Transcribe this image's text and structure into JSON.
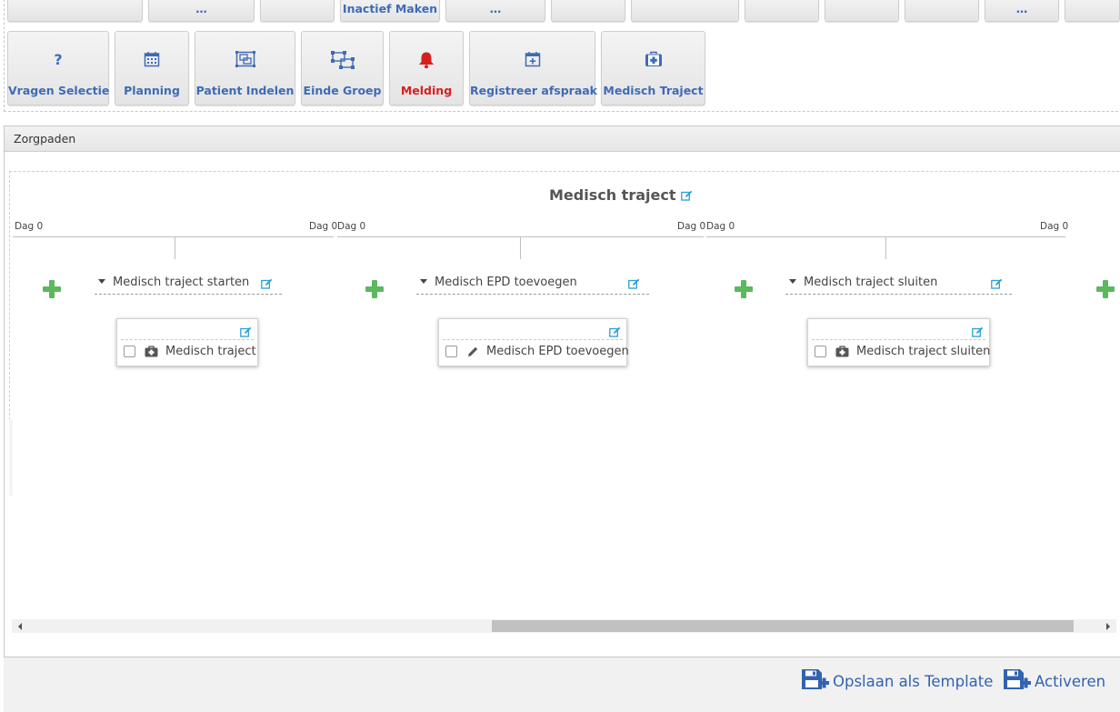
{
  "toolbar": {
    "row1": [
      {
        "label": ""
      },
      {
        "label": "…"
      },
      {
        "label": ""
      },
      {
        "label": "Inactief Maken"
      },
      {
        "label": "…"
      },
      {
        "label": ""
      },
      {
        "label": ""
      },
      {
        "label": ""
      },
      {
        "label": ""
      },
      {
        "label": ""
      },
      {
        "label": "…"
      },
      {
        "label": ""
      }
    ],
    "row2": [
      {
        "label": "Vragen Selectie",
        "icon": "question-icon"
      },
      {
        "label": "Planning",
        "icon": "calendar-icon"
      },
      {
        "label": "Patient Indelen",
        "icon": "group-icon"
      },
      {
        "label": "Einde Groep",
        "icon": "ungroup-icon"
      },
      {
        "label": "Melding",
        "icon": "bell-icon",
        "color": "#d62020"
      },
      {
        "label": "Registreer afspraak",
        "icon": "calendar-plus-icon"
      },
      {
        "label": "Medisch Traject",
        "icon": "medkit-icon"
      }
    ]
  },
  "panel": {
    "title": "Zorgpaden",
    "pathway_title": "Medisch traject",
    "timelines": [
      {
        "start": "Dag 0",
        "end": "Dag 0"
      },
      {
        "start": "Dag 0",
        "end": "Dag 0"
      },
      {
        "start": "Dag 0",
        "end": "Dag 0"
      }
    ],
    "steps": [
      {
        "title": "Medisch traject starten",
        "task": "Medisch traject",
        "task_icon": "medkit-icon"
      },
      {
        "title": "Medisch EPD toevoegen",
        "task": "Medisch EPD toevoegen",
        "task_icon": "pencil-icon"
      },
      {
        "title": "Medisch traject sluiten",
        "task": "Medisch traject sluiten",
        "task_icon": "medkit-icon"
      }
    ]
  },
  "footer": {
    "save_template": "Opslaan als Template",
    "activate": "Activeren"
  },
  "colors": {
    "accent": "#3f6bb5",
    "alert": "#d62020",
    "add": "#5cb85c",
    "edit_icon": "#2a9fd6"
  }
}
